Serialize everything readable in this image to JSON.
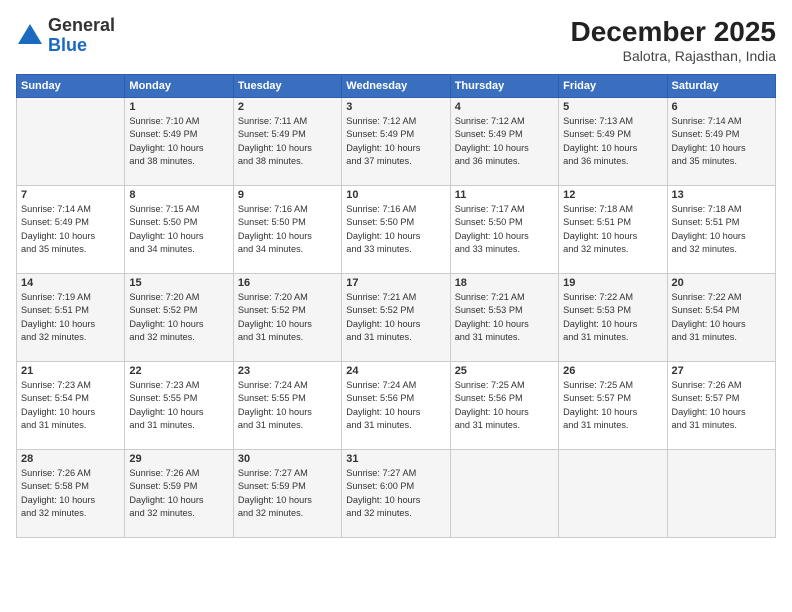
{
  "logo": {
    "general": "General",
    "blue": "Blue"
  },
  "title": "December 2025",
  "subtitle": "Balotra, Rajasthan, India",
  "days_of_week": [
    "Sunday",
    "Monday",
    "Tuesday",
    "Wednesday",
    "Thursday",
    "Friday",
    "Saturday"
  ],
  "weeks": [
    [
      {
        "day": "",
        "lines": []
      },
      {
        "day": "1",
        "lines": [
          "Sunrise: 7:10 AM",
          "Sunset: 5:49 PM",
          "Daylight: 10 hours",
          "and 38 minutes."
        ]
      },
      {
        "day": "2",
        "lines": [
          "Sunrise: 7:11 AM",
          "Sunset: 5:49 PM",
          "Daylight: 10 hours",
          "and 38 minutes."
        ]
      },
      {
        "day": "3",
        "lines": [
          "Sunrise: 7:12 AM",
          "Sunset: 5:49 PM",
          "Daylight: 10 hours",
          "and 37 minutes."
        ]
      },
      {
        "day": "4",
        "lines": [
          "Sunrise: 7:12 AM",
          "Sunset: 5:49 PM",
          "Daylight: 10 hours",
          "and 36 minutes."
        ]
      },
      {
        "day": "5",
        "lines": [
          "Sunrise: 7:13 AM",
          "Sunset: 5:49 PM",
          "Daylight: 10 hours",
          "and 36 minutes."
        ]
      },
      {
        "day": "6",
        "lines": [
          "Sunrise: 7:14 AM",
          "Sunset: 5:49 PM",
          "Daylight: 10 hours",
          "and 35 minutes."
        ]
      }
    ],
    [
      {
        "day": "7",
        "lines": [
          "Sunrise: 7:14 AM",
          "Sunset: 5:49 PM",
          "Daylight: 10 hours",
          "and 35 minutes."
        ]
      },
      {
        "day": "8",
        "lines": [
          "Sunrise: 7:15 AM",
          "Sunset: 5:50 PM",
          "Daylight: 10 hours",
          "and 34 minutes."
        ]
      },
      {
        "day": "9",
        "lines": [
          "Sunrise: 7:16 AM",
          "Sunset: 5:50 PM",
          "Daylight: 10 hours",
          "and 34 minutes."
        ]
      },
      {
        "day": "10",
        "lines": [
          "Sunrise: 7:16 AM",
          "Sunset: 5:50 PM",
          "Daylight: 10 hours",
          "and 33 minutes."
        ]
      },
      {
        "day": "11",
        "lines": [
          "Sunrise: 7:17 AM",
          "Sunset: 5:50 PM",
          "Daylight: 10 hours",
          "and 33 minutes."
        ]
      },
      {
        "day": "12",
        "lines": [
          "Sunrise: 7:18 AM",
          "Sunset: 5:51 PM",
          "Daylight: 10 hours",
          "and 32 minutes."
        ]
      },
      {
        "day": "13",
        "lines": [
          "Sunrise: 7:18 AM",
          "Sunset: 5:51 PM",
          "Daylight: 10 hours",
          "and 32 minutes."
        ]
      }
    ],
    [
      {
        "day": "14",
        "lines": [
          "Sunrise: 7:19 AM",
          "Sunset: 5:51 PM",
          "Daylight: 10 hours",
          "and 32 minutes."
        ]
      },
      {
        "day": "15",
        "lines": [
          "Sunrise: 7:20 AM",
          "Sunset: 5:52 PM",
          "Daylight: 10 hours",
          "and 32 minutes."
        ]
      },
      {
        "day": "16",
        "lines": [
          "Sunrise: 7:20 AM",
          "Sunset: 5:52 PM",
          "Daylight: 10 hours",
          "and 31 minutes."
        ]
      },
      {
        "day": "17",
        "lines": [
          "Sunrise: 7:21 AM",
          "Sunset: 5:52 PM",
          "Daylight: 10 hours",
          "and 31 minutes."
        ]
      },
      {
        "day": "18",
        "lines": [
          "Sunrise: 7:21 AM",
          "Sunset: 5:53 PM",
          "Daylight: 10 hours",
          "and 31 minutes."
        ]
      },
      {
        "day": "19",
        "lines": [
          "Sunrise: 7:22 AM",
          "Sunset: 5:53 PM",
          "Daylight: 10 hours",
          "and 31 minutes."
        ]
      },
      {
        "day": "20",
        "lines": [
          "Sunrise: 7:22 AM",
          "Sunset: 5:54 PM",
          "Daylight: 10 hours",
          "and 31 minutes."
        ]
      }
    ],
    [
      {
        "day": "21",
        "lines": [
          "Sunrise: 7:23 AM",
          "Sunset: 5:54 PM",
          "Daylight: 10 hours",
          "and 31 minutes."
        ]
      },
      {
        "day": "22",
        "lines": [
          "Sunrise: 7:23 AM",
          "Sunset: 5:55 PM",
          "Daylight: 10 hours",
          "and 31 minutes."
        ]
      },
      {
        "day": "23",
        "lines": [
          "Sunrise: 7:24 AM",
          "Sunset: 5:55 PM",
          "Daylight: 10 hours",
          "and 31 minutes."
        ]
      },
      {
        "day": "24",
        "lines": [
          "Sunrise: 7:24 AM",
          "Sunset: 5:56 PM",
          "Daylight: 10 hours",
          "and 31 minutes."
        ]
      },
      {
        "day": "25",
        "lines": [
          "Sunrise: 7:25 AM",
          "Sunset: 5:56 PM",
          "Daylight: 10 hours",
          "and 31 minutes."
        ]
      },
      {
        "day": "26",
        "lines": [
          "Sunrise: 7:25 AM",
          "Sunset: 5:57 PM",
          "Daylight: 10 hours",
          "and 31 minutes."
        ]
      },
      {
        "day": "27",
        "lines": [
          "Sunrise: 7:26 AM",
          "Sunset: 5:57 PM",
          "Daylight: 10 hours",
          "and 31 minutes."
        ]
      }
    ],
    [
      {
        "day": "28",
        "lines": [
          "Sunrise: 7:26 AM",
          "Sunset: 5:58 PM",
          "Daylight: 10 hours",
          "and 32 minutes."
        ]
      },
      {
        "day": "29",
        "lines": [
          "Sunrise: 7:26 AM",
          "Sunset: 5:59 PM",
          "Daylight: 10 hours",
          "and 32 minutes."
        ]
      },
      {
        "day": "30",
        "lines": [
          "Sunrise: 7:27 AM",
          "Sunset: 5:59 PM",
          "Daylight: 10 hours",
          "and 32 minutes."
        ]
      },
      {
        "day": "31",
        "lines": [
          "Sunrise: 7:27 AM",
          "Sunset: 6:00 PM",
          "Daylight: 10 hours",
          "and 32 minutes."
        ]
      },
      {
        "day": "",
        "lines": []
      },
      {
        "day": "",
        "lines": []
      },
      {
        "day": "",
        "lines": []
      }
    ]
  ]
}
